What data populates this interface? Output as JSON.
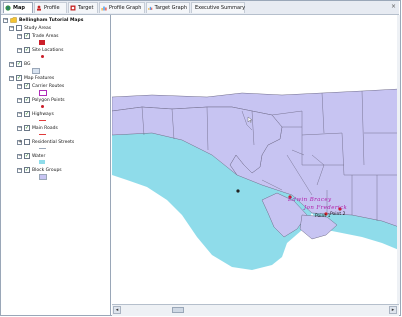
{
  "tabs": [
    {
      "label": "Map",
      "icon": "globe-icon",
      "color": "#2e7d32",
      "active": true
    },
    {
      "label": "Profile",
      "icon": "profile-icon",
      "color": "#c62828"
    },
    {
      "label": "Target",
      "icon": "target-icon",
      "color": "#c62828"
    },
    {
      "label": "Profile Graph",
      "icon": "graph-icon",
      "color": "#f9a825"
    },
    {
      "label": "Target Graph",
      "icon": "graph-icon",
      "color": "#f9a825"
    },
    {
      "label": "Executive Summary",
      "icon": "document-icon",
      "color": "#ef6c00"
    }
  ],
  "close_glyph": "×",
  "toc": {
    "root": "Bellingham Tutorial Maps",
    "study_areas": "Study Areas",
    "trade_areas": "Trade Areas",
    "site_locations": "Site Locations",
    "bg": "BG",
    "map_features": "Map Features",
    "carrier_routes": "Carrier Routes",
    "polygon_points": "Polygon Points",
    "highways": "Highways",
    "main_roads": "Main Roads",
    "residential_streets": "Residential Streets",
    "water": "Water",
    "block_groups": "Block Groups"
  },
  "map_labels": {
    "label_a": "Edwin Bracey",
    "label_b": "Jon Frederick",
    "label_c": "Point 1",
    "label_d": "Point 2"
  },
  "colors": {
    "land": "#c7c4f2",
    "water": "#8fdcea",
    "boundary": "#6e6a88",
    "site": "#cc1f2a",
    "highway": "#e03b3b",
    "label_magenta": "#b01ca8"
  }
}
